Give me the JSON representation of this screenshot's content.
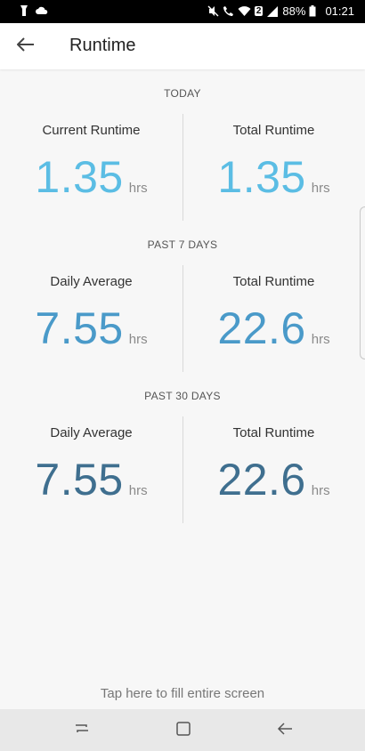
{
  "status_bar": {
    "battery": "88%",
    "time": "01:21",
    "sim_badge": "2"
  },
  "app_bar": {
    "title": "Runtime"
  },
  "colors": {
    "today_value": "#5bbde4",
    "past7_value": "#4a9ac9",
    "past30_value": "#3f6f8f"
  },
  "sections": [
    {
      "label": "TODAY",
      "left": {
        "label": "Current Runtime",
        "value": "1.35",
        "unit": "hrs"
      },
      "right": {
        "label": "Total Runtime",
        "value": "1.35",
        "unit": "hrs"
      }
    },
    {
      "label": "PAST 7 DAYS",
      "left": {
        "label": "Daily Average",
        "value": "7.55",
        "unit": "hrs"
      },
      "right": {
        "label": "Total Runtime",
        "value": "22.6",
        "unit": "hrs"
      }
    },
    {
      "label": "PAST 30 DAYS",
      "left": {
        "label": "Daily Average",
        "value": "7.55",
        "unit": "hrs"
      },
      "right": {
        "label": "Total Runtime",
        "value": "22.6",
        "unit": "hrs"
      }
    }
  ],
  "footer": {
    "tap_hint": "Tap here to fill entire screen"
  }
}
